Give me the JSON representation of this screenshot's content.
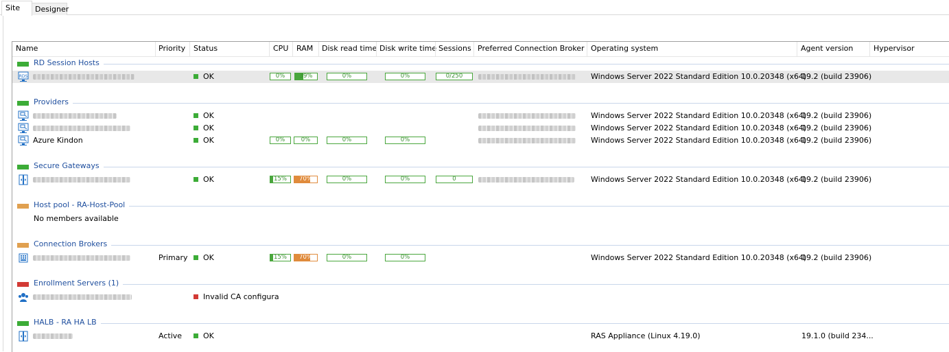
{
  "tabs": [
    {
      "label": "Site",
      "active": true
    },
    {
      "label": "Designer",
      "active": false
    }
  ],
  "columns": {
    "name": "Name",
    "priority": "Priority",
    "status": "Status",
    "cpu": "CPU",
    "ram": "RAM",
    "disk_read": "Disk read time",
    "disk_write": "Disk write time",
    "sessions": "Sessions",
    "broker": "Preferred Connection Broker",
    "os": "Operating system",
    "agent": "Agent version",
    "hypervisor": "Hypervisor"
  },
  "colors": {
    "ok": "#3cac37",
    "error": "#d23a35",
    "group_green": "#3cac37",
    "group_orange": "#e0a050",
    "group_red": "#d23a35",
    "link_blue": "#1e4e9e"
  },
  "groups": {
    "rdsh": {
      "title": "RD Session Hosts",
      "rows": [
        {
          "status": "OK",
          "cpu": "0%",
          "ram": "39%",
          "ram_level": 0.39,
          "disk_read": "0%",
          "disk_write": "0%",
          "sessions": "0/250",
          "os": "Windows Server 2022 Standard Edition 10.0.20348 (x64)",
          "agent": "19.2 (build 23906)"
        }
      ]
    },
    "providers": {
      "title": "Providers",
      "rows": [
        {
          "status": "OK",
          "os": "Windows Server 2022 Standard Edition 10.0.20348 (x64)",
          "agent": "19.2 (build 23906)"
        },
        {
          "status": "OK",
          "os": "Windows Server 2022 Standard Edition 10.0.20348 (x64)",
          "agent": "19.2 (build 23906)"
        },
        {
          "name": "Azure Kindon",
          "status": "OK",
          "cpu": "0%",
          "ram": "0%",
          "disk_read": "0%",
          "disk_write": "0%",
          "os": "Windows Server 2022 Standard Edition 10.0.20348 (x64)",
          "agent": "19.2 (build 23906)"
        }
      ]
    },
    "gateways": {
      "title": "Secure Gateways",
      "rows": [
        {
          "status": "OK",
          "cpu": "15%",
          "cpu_level": 0.15,
          "ram": "70%",
          "ram_level": 0.7,
          "disk_read": "0%",
          "disk_write": "0%",
          "sessions": "0",
          "os": "Windows Server 2022 Standard Edition 10.0.20348 (x64)",
          "agent": "19.2 (build 23906)"
        }
      ]
    },
    "hostpool": {
      "title": "Host pool - RA-Host-Pool",
      "empty": "No members available"
    },
    "brokers": {
      "title": "Connection Brokers",
      "rows": [
        {
          "priority": "Primary",
          "status": "OK",
          "cpu": "15%",
          "cpu_level": 0.15,
          "ram": "70%",
          "ram_level": 0.7,
          "disk_read": "0%",
          "disk_write": "0%",
          "os": "Windows Server 2022 Standard Edition 10.0.20348 (x64)",
          "agent": "19.2 (build 23906)"
        }
      ]
    },
    "enrollment": {
      "title": "Enrollment Servers (1)",
      "rows": [
        {
          "status": "Invalid CA configura"
        }
      ]
    },
    "halb": {
      "title": "HALB - RA HA LB",
      "rows": [
        {
          "priority": "Active",
          "status": "OK",
          "os": "RAS Appliance (Linux 4.19.0)",
          "agent": "19.1.0 (build 234..."
        }
      ]
    }
  }
}
